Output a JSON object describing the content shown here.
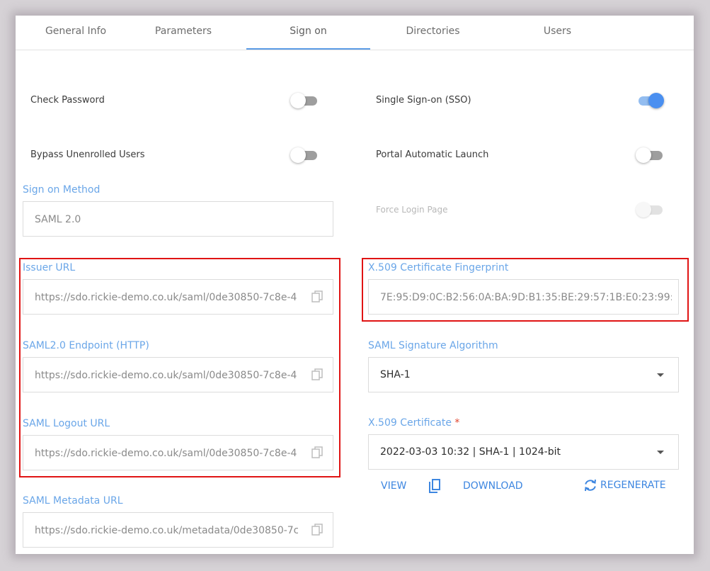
{
  "tabs": [
    {
      "label": "General Info"
    },
    {
      "label": "Parameters"
    },
    {
      "label": "Sign on"
    },
    {
      "label": "Directories"
    },
    {
      "label": "Users"
    }
  ],
  "active_tab": "Sign on",
  "toggles": {
    "check_password": {
      "label": "Check Password",
      "state": "off"
    },
    "sso": {
      "label": "Single Sign-on (SSO)",
      "state": "on"
    },
    "bypass_unenrolled": {
      "label": "Bypass Unenrolled Users",
      "state": "off"
    },
    "portal_auto_launch": {
      "label": "Portal Automatic Launch",
      "state": "off"
    },
    "force_login": {
      "label": "Force Login Page",
      "state": "disabled"
    }
  },
  "sign_on_method": {
    "label": "Sign on Method",
    "value": "SAML 2.0"
  },
  "issuer_url": {
    "label": "Issuer URL",
    "value": "https://sdo.rickie-demo.co.uk/saml/0de30850-7c8e-4:"
  },
  "saml_endpoint": {
    "label": "SAML2.0 Endpoint (HTTP)",
    "value": "https://sdo.rickie-demo.co.uk/saml/0de30850-7c8e-4:"
  },
  "saml_logout": {
    "label": "SAML Logout URL",
    "value": "https://sdo.rickie-demo.co.uk/saml/0de30850-7c8e-4:"
  },
  "saml_metadata": {
    "label": "SAML Metadata URL",
    "value": "https://sdo.rickie-demo.co.uk/metadata/0de30850-7c"
  },
  "cert_fingerprint": {
    "label": "X.509 Certificate Fingerprint",
    "value": "7E:95:D9:0C:B2:56:0A:BA:9D:B1:35:BE:29:57:1B:E0:23:99:F"
  },
  "signature_algorithm": {
    "label": "SAML Signature Algorithm",
    "value": "SHA-1"
  },
  "certificate": {
    "label": "X.509 Certificate",
    "required_mark": "*",
    "value": "2022-03-03 10:32 | SHA-1 | 1024-bit"
  },
  "actions": {
    "view": "VIEW",
    "download": "DOWNLOAD",
    "regenerate": "REGENERATE"
  },
  "colors": {
    "accent": "#5b9be6",
    "label_blue": "#6aa6e8",
    "highlight": "#e01414",
    "toggle_on": "#4a8ff0"
  }
}
